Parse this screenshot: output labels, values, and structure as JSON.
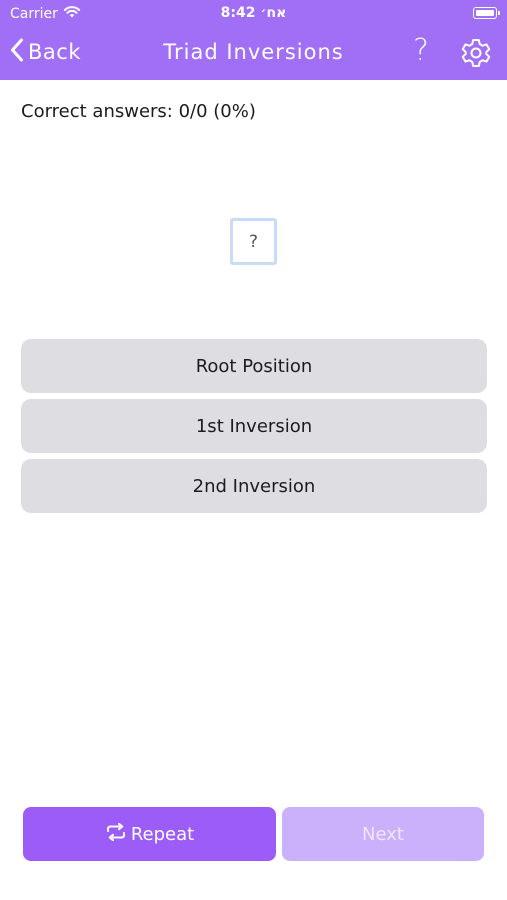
{
  "status_bar": {
    "carrier": "Carrier",
    "time": "אח׳ 8:42"
  },
  "nav": {
    "back_label": "Back",
    "title": "Triad Inversions",
    "help_label": "?"
  },
  "score": {
    "text": "Correct answers: 0/0 (0%)"
  },
  "question": {
    "placeholder": "?"
  },
  "answers": [
    {
      "label": "Root Position"
    },
    {
      "label": "1st Inversion"
    },
    {
      "label": "2nd Inversion"
    }
  ],
  "actions": {
    "repeat_label": "Repeat",
    "next_label": "Next"
  },
  "colors": {
    "accent": "#a16ef6",
    "repeat_button": "#9b5cf7",
    "next_button_disabled": "#cbb1fb",
    "answer_button": "#dedde1"
  },
  "icons": {
    "back": "chevron-left-icon",
    "settings": "gear-icon",
    "repeat": "repeat-icon",
    "wifi": "wifi-icon",
    "battery": "battery-icon"
  }
}
